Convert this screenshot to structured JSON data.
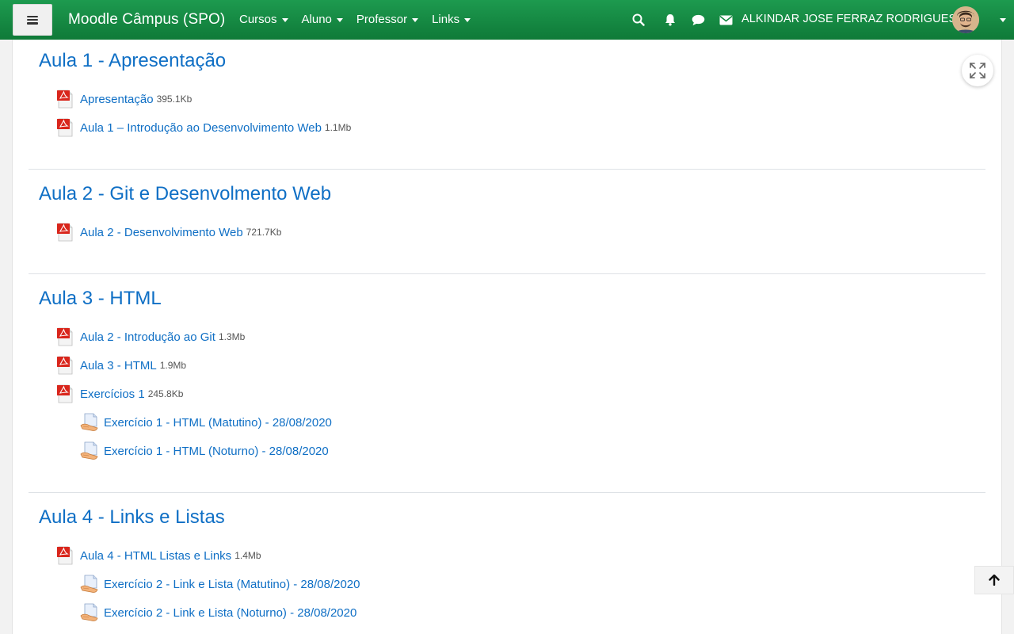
{
  "navbar": {
    "brand": "Moodle Câmpus (SPO)",
    "menu": [
      {
        "label": "Cursos"
      },
      {
        "label": "Aluno"
      },
      {
        "label": "Professor"
      },
      {
        "label": "Links"
      }
    ],
    "icons": [
      "search-icon",
      "bell-icon",
      "chat-icon",
      "envelope-icon"
    ],
    "user_name": "ALKINDAR JOSE FERRAZ RODRIGUES"
  },
  "colors": {
    "navbar": "#14883f",
    "link": "#0f6fc5",
    "pdf_red": "#d9261c"
  },
  "sections": [
    {
      "title": "Aula 1 - Apresentação",
      "activities": [
        {
          "type": "pdf",
          "label": "Apresentação",
          "size": "395.1Kb"
        },
        {
          "type": "pdf",
          "label": "Aula 1 – Introdução ao Desenvolvimento Web",
          "size": "1.1Mb"
        }
      ]
    },
    {
      "title": "Aula 2 - Git e Desenvolmento Web",
      "activities": [
        {
          "type": "pdf",
          "label": "Aula 2 - Desenvolvimento Web",
          "size": "721.7Kb"
        }
      ]
    },
    {
      "title": "Aula 3 - HTML",
      "activities": [
        {
          "type": "pdf",
          "label": "Aula 2 - Introdução ao Git",
          "size": "1.3Mb"
        },
        {
          "type": "pdf",
          "label": "Aula 3 - HTML",
          "size": "1.9Mb"
        },
        {
          "type": "pdf",
          "label": "Exercícios 1",
          "size": "245.8Kb"
        },
        {
          "type": "assign",
          "label": "Exercício 1 - HTML (Matutino) - 28/08/2020"
        },
        {
          "type": "assign",
          "label": "Exercício 1 - HTML (Noturno) - 28/08/2020"
        }
      ]
    },
    {
      "title": "Aula 4 - Links e Listas",
      "activities": [
        {
          "type": "pdf",
          "label": "Aula 4 - HTML Listas e Links",
          "size": "1.4Mb"
        },
        {
          "type": "assign",
          "label": "Exercício 2 - Link e Lista (Matutino) - 28/08/2020"
        },
        {
          "type": "assign",
          "label": "Exercício 2 - Link e Lista (Noturno) - 28/08/2020"
        }
      ]
    }
  ]
}
